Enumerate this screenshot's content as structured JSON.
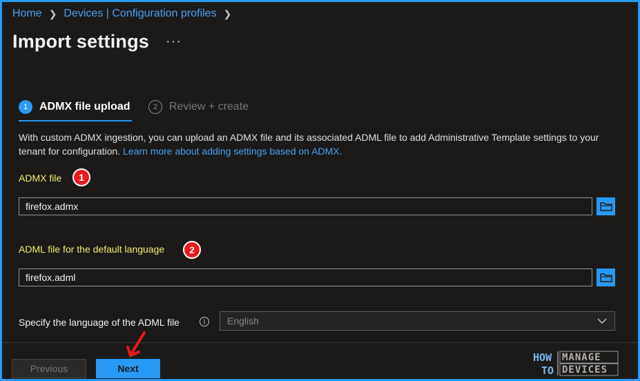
{
  "breadcrumb": {
    "home": "Home",
    "devices": "Devices | Configuration profiles"
  },
  "page": {
    "title": "Import settings",
    "more": "···"
  },
  "tabs": [
    {
      "number": "1",
      "label": "ADMX file upload",
      "active": true
    },
    {
      "number": "2",
      "label": "Review + create",
      "active": false
    }
  ],
  "description": {
    "text": "With custom ADMX ingestion, you can upload an ADMX file and its associated ADML file to add Administrative Template settings to your tenant for configuration.",
    "link": "Learn more about adding settings based on ADMX."
  },
  "admx": {
    "label": "ADMX file",
    "value": "firefox.admx",
    "badge": "1"
  },
  "adml": {
    "label": "ADML file for the default language",
    "value": "firefox.adml",
    "badge": "2"
  },
  "language": {
    "label": "Specify the language of the ADML file",
    "info": "i",
    "value": "English"
  },
  "footer": {
    "previous": "Previous",
    "next": "Next"
  },
  "logo": {
    "line1": "HOW",
    "line2": "TO",
    "word1": "MANAGE",
    "word2": "DEVICES"
  },
  "colors": {
    "accent": "#2899f5",
    "label_highlight": "#f4ef6b",
    "badge": "#e8191b",
    "background": "#1b1a19"
  }
}
